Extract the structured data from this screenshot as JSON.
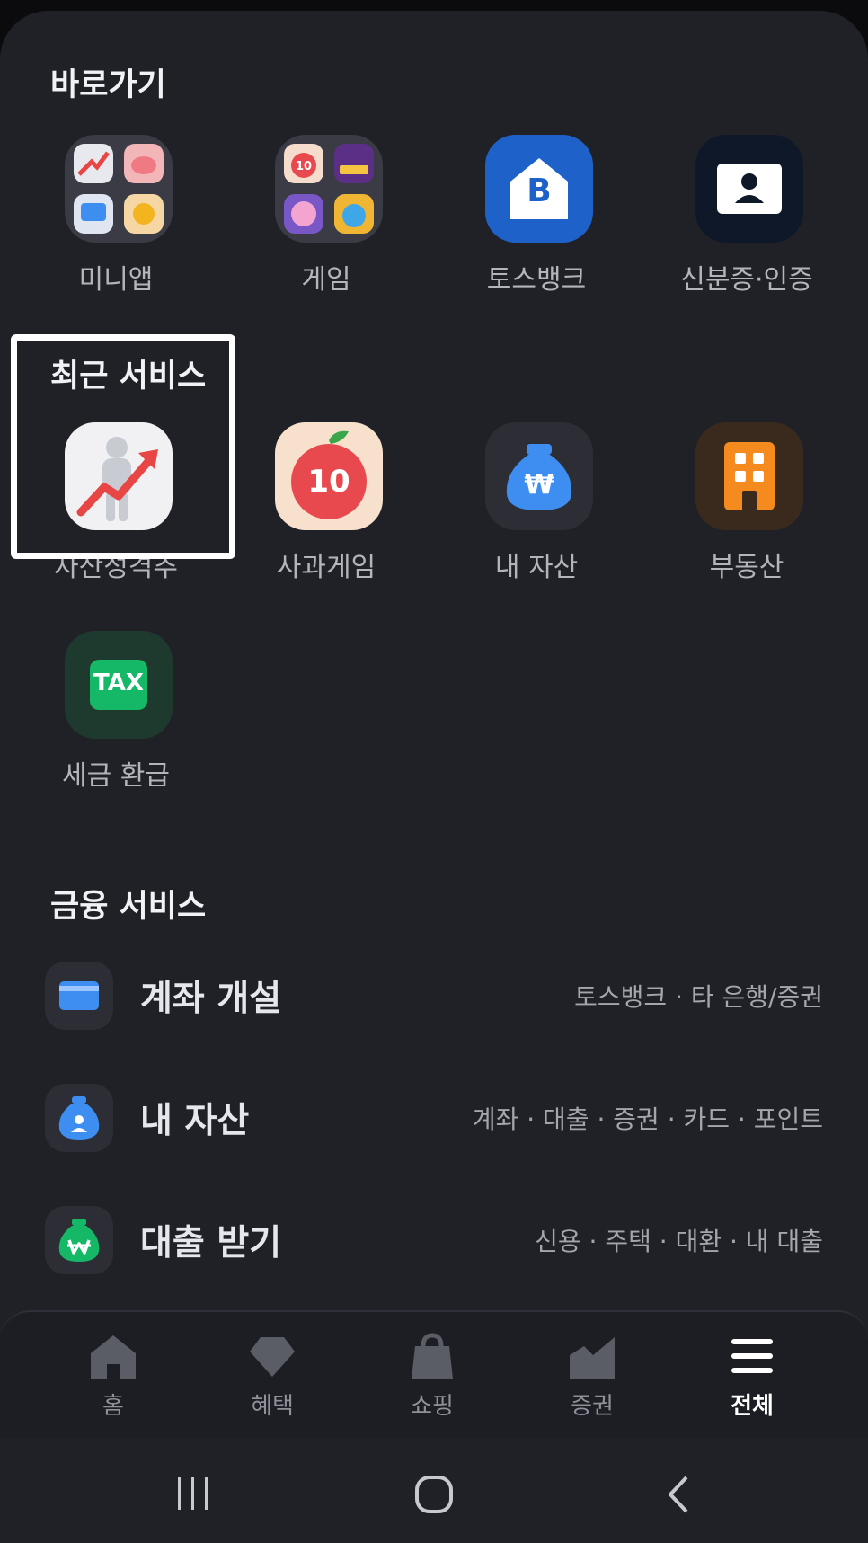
{
  "shortcuts": {
    "title": "바로가기",
    "items": [
      {
        "label": "미니앱",
        "icon": "mini-app-folder-icon"
      },
      {
        "label": "게임",
        "icon": "game-folder-icon"
      },
      {
        "label": "토스뱅크",
        "icon": "toss-bank-icon",
        "badge": "B"
      },
      {
        "label": "신분증·인증",
        "icon": "id-card-icon"
      }
    ]
  },
  "recent": {
    "title": "최근 서비스",
    "items": [
      {
        "label": "자산성격추",
        "icon": "asset-growth-icon"
      },
      {
        "label": "사과게임",
        "icon": "apple-game-icon",
        "badge": "10"
      },
      {
        "label": "내 자산",
        "icon": "money-bag-icon",
        "badge": "₩"
      },
      {
        "label": "부동산",
        "icon": "building-icon"
      },
      {
        "label": "세금 환급",
        "icon": "tax-icon",
        "badge": "TAX"
      }
    ]
  },
  "finance": {
    "title": "금융 서비스",
    "items": [
      {
        "title": "계좌 개설",
        "sub": "토스뱅크 · 타 은행/증권",
        "icon": "bank-card-icon"
      },
      {
        "title": "내 자산",
        "sub": "계좌 · 대출 · 증권 · 카드 · 포인트",
        "icon": "blue-money-bag-icon"
      },
      {
        "title": "대출 받기",
        "sub": "신용 · 주택 · 대환 · 내 대출",
        "icon": "green-money-bag-icon"
      }
    ]
  },
  "nav": [
    {
      "label": "홈",
      "icon": "home-icon"
    },
    {
      "label": "혜택",
      "icon": "gem-icon"
    },
    {
      "label": "쇼핑",
      "icon": "shopping-bag-icon"
    },
    {
      "label": "증권",
      "icon": "chart-icon"
    },
    {
      "label": "전체",
      "icon": "menu-icon",
      "active": true
    }
  ],
  "colors": {
    "background": "#202027",
    "toss_blue": "#1e62c9",
    "tax_green": "#14b866",
    "realestate_orange": "#f58a1f",
    "apple_red": "#e8494e"
  }
}
